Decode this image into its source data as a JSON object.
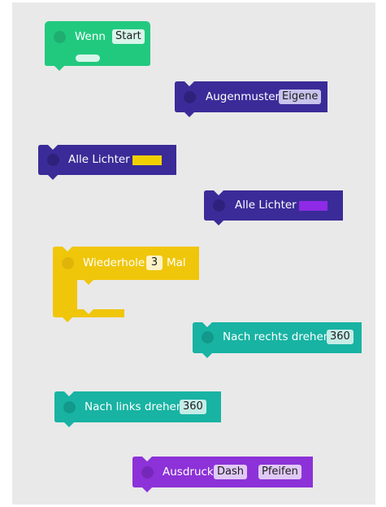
{
  "blocks": {
    "wenn_start": {
      "label": "Wenn",
      "param": "Start",
      "color": "#21c97f"
    },
    "augenmuster": {
      "label": "Augenmuster",
      "param": "Eigene",
      "color": "#3a2b98"
    },
    "alle_lichter_1": {
      "label": "Alle Lichter",
      "swatch_color": "#f2d000",
      "color": "#3a2b98"
    },
    "alle_lichter_2": {
      "label": "Alle Lichter",
      "swatch_color": "#8f2ae6",
      "color": "#3a2b98"
    },
    "wiederhole": {
      "label_before": "Wiederhole",
      "param": "3",
      "label_after": "Mal",
      "color": "#f0c60b"
    },
    "nach_rechts": {
      "label": "Nach rechts drehen",
      "param": "360",
      "color": "#18b3a3"
    },
    "nach_links": {
      "label": "Nach links drehen",
      "param": "360",
      "color": "#18b3a3"
    },
    "ausdruck": {
      "label": "Ausdruck",
      "param1": "Dash",
      "param2": "Pfeifen",
      "color": "#8c32d8"
    }
  }
}
